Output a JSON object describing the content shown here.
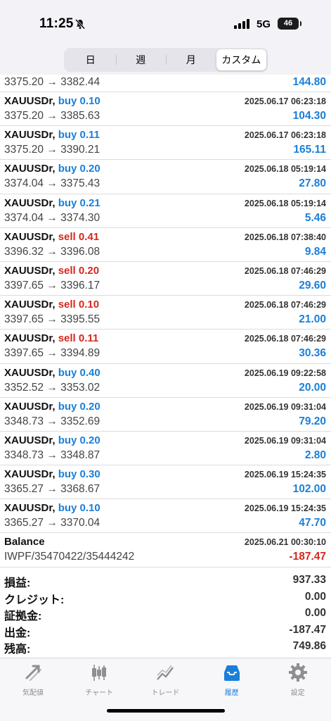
{
  "status": {
    "time": "11:25",
    "network": "5G",
    "battery": "46"
  },
  "segments": [
    {
      "label": "日",
      "active": false
    },
    {
      "label": "週",
      "active": false
    },
    {
      "label": "月",
      "active": false
    },
    {
      "label": "カスタム",
      "active": true
    }
  ],
  "first_row": {
    "prices": "3375.20 → 3382.44",
    "profit": "144.80"
  },
  "trades": [
    {
      "symbol": "XAUUSDr,",
      "side": "buy",
      "volume": "0.10",
      "time": "2025.06.17 06:23:18",
      "prices": "3375.20 → 3385.63",
      "profit": "104.30"
    },
    {
      "symbol": "XAUUSDr,",
      "side": "buy",
      "volume": "0.11",
      "time": "2025.06.17 06:23:18",
      "prices": "3375.20 → 3390.21",
      "profit": "165.11"
    },
    {
      "symbol": "XAUUSDr,",
      "side": "buy",
      "volume": "0.20",
      "time": "2025.06.18 05:19:14",
      "prices": "3374.04 → 3375.43",
      "profit": "27.80"
    },
    {
      "symbol": "XAUUSDr,",
      "side": "buy",
      "volume": "0.21",
      "time": "2025.06.18 05:19:14",
      "prices": "3374.04 → 3374.30",
      "profit": "5.46"
    },
    {
      "symbol": "XAUUSDr,",
      "side": "sell",
      "volume": "0.41",
      "time": "2025.06.18 07:38:40",
      "prices": "3396.32 → 3396.08",
      "profit": "9.84"
    },
    {
      "symbol": "XAUUSDr,",
      "side": "sell",
      "volume": "0.20",
      "time": "2025.06.18 07:46:29",
      "prices": "3397.65 → 3396.17",
      "profit": "29.60"
    },
    {
      "symbol": "XAUUSDr,",
      "side": "sell",
      "volume": "0.10",
      "time": "2025.06.18 07:46:29",
      "prices": "3397.65 → 3395.55",
      "profit": "21.00"
    },
    {
      "symbol": "XAUUSDr,",
      "side": "sell",
      "volume": "0.11",
      "time": "2025.06.18 07:46:29",
      "prices": "3397.65 → 3394.89",
      "profit": "30.36"
    },
    {
      "symbol": "XAUUSDr,",
      "side": "buy",
      "volume": "0.40",
      "time": "2025.06.19 09:22:58",
      "prices": "3352.52 → 3353.02",
      "profit": "20.00"
    },
    {
      "symbol": "XAUUSDr,",
      "side": "buy",
      "volume": "0.20",
      "time": "2025.06.19 09:31:04",
      "prices": "3348.73 → 3352.69",
      "profit": "79.20"
    },
    {
      "symbol": "XAUUSDr,",
      "side": "buy",
      "volume": "0.20",
      "time": "2025.06.19 09:31:04",
      "prices": "3348.73 → 3348.87",
      "profit": "2.80"
    },
    {
      "symbol": "XAUUSDr,",
      "side": "buy",
      "volume": "0.30",
      "time": "2025.06.19 15:24:35",
      "prices": "3365.27 → 3368.67",
      "profit": "102.00"
    },
    {
      "symbol": "XAUUSDr,",
      "side": "buy",
      "volume": "0.10",
      "time": "2025.06.19 15:24:35",
      "prices": "3365.27 → 3370.04",
      "profit": "47.70"
    }
  ],
  "balance_row": {
    "title": "Balance",
    "time": "2025.06.21 00:30:10",
    "comment": "IWPF/35470422/35444242",
    "amount": "-187.47"
  },
  "summary": [
    {
      "label": "損益:",
      "value": "937.33"
    },
    {
      "label": "クレジット:",
      "value": "0.00"
    },
    {
      "label": "証拠金:",
      "value": "0.00"
    },
    {
      "label": "出金:",
      "value": "-187.47"
    },
    {
      "label": "残高:",
      "value": "749.86"
    }
  ],
  "tabs": [
    {
      "label": "気配値",
      "icon": "quotes-icon",
      "active": false
    },
    {
      "label": "チャート",
      "icon": "chart-icon",
      "active": false
    },
    {
      "label": "トレード",
      "icon": "trade-icon",
      "active": false
    },
    {
      "label": "履歴",
      "icon": "history-icon",
      "active": true
    },
    {
      "label": "設定",
      "icon": "settings-icon",
      "active": false
    }
  ],
  "colors": {
    "buy": "#1a7fd8",
    "sell": "#d6281e",
    "profit": "#1a7fd8",
    "loss": "#d6281e",
    "active_tab": "#1a7fd8",
    "inactive_tab": "#8e8e93"
  }
}
